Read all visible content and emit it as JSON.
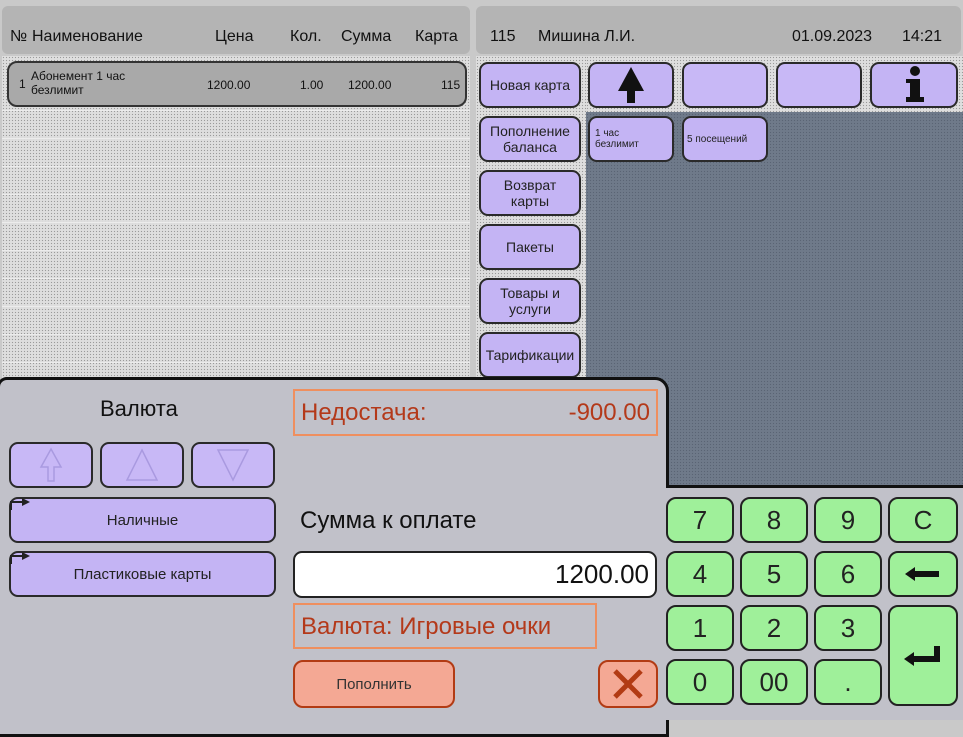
{
  "order_header": {
    "col_no": "№",
    "col_name": "Наименование",
    "col_price": "Цена",
    "col_qty": "Кол.",
    "col_sum": "Сумма",
    "col_card": "Карта"
  },
  "order_rows": [
    {
      "no": "1",
      "name_line1": "Абонемент 1 час",
      "name_line2": "безлимит",
      "price": "1200.00",
      "qty": "1.00",
      "sum": "1200.00",
      "card": "115"
    }
  ],
  "status_bar": {
    "card": "115",
    "cashier": "Мишина Л.И.",
    "date": "01.09.2023",
    "time": "14:21"
  },
  "categories": [
    "Новая карта",
    "Пополнение баланса",
    "Возврат карты",
    "Пакеты",
    "Товары и услуги",
    "Тарификации"
  ],
  "products": [
    {
      "line1": "1 час",
      "line2": "безлимит"
    },
    {
      "line1": "5 посещений",
      "line2": ""
    }
  ],
  "payment": {
    "currency_title": "Валюта",
    "methods": [
      "Наличные",
      "Пластиковые карты"
    ],
    "shortage_label": "Недостача:",
    "shortage_value": "-900.00",
    "amount_label": "Сумма к оплате",
    "amount_value": "1200.00",
    "currency_line": "Валюта: Игровые очки",
    "topup_label": "Пополнить"
  },
  "keypad": {
    "k7": "7",
    "k8": "8",
    "k9": "9",
    "kc": "C",
    "k4": "4",
    "k5": "5",
    "k6": "6",
    "k1": "1",
    "k2": "2",
    "k3": "3",
    "k0": "0",
    "k00": "00",
    "kdot": "."
  },
  "colors": {
    "purple_button": "#c4b4f4",
    "green_key": "#9ff09a",
    "alert_text": "#b4391a",
    "alert_border": "#ef8f5f",
    "topup_button": "#f4a894"
  },
  "icons": {
    "nav_up": "tree-up-icon",
    "info": "info-icon",
    "backspace": "backspace-arrow-icon",
    "enter": "enter-arrow-icon",
    "cancel": "close-icon"
  }
}
